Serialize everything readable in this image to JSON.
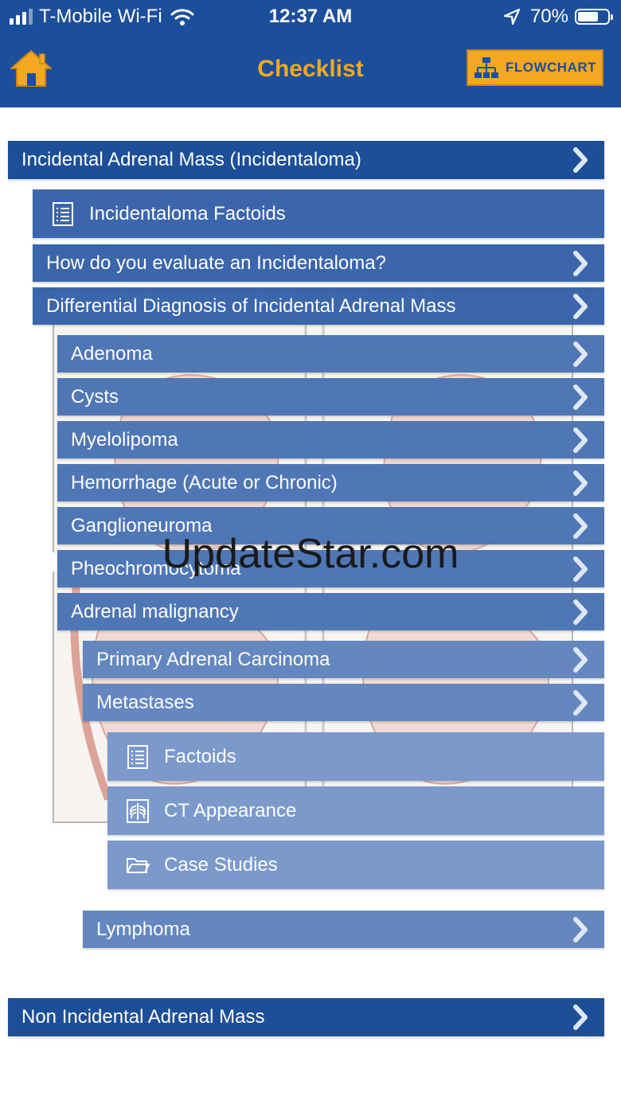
{
  "status_bar": {
    "carrier": "T-Mobile Wi-Fi",
    "time": "12:37 AM",
    "battery": "70%",
    "battery_level": 0.7
  },
  "nav": {
    "title": "Checklist",
    "flowchart_label": "FLOWCHART",
    "home_icon": "home-icon",
    "flowchart_icon": "flowchart-icon"
  },
  "colors": {
    "nav_bar": "#1b4f9b",
    "accent": "#f4a720",
    "level_0": "#1d4f98",
    "level_1": "#3b66ab",
    "level_2": "#4f77b5",
    "level_3": "#6487c0",
    "level_4": "#7b9acb"
  },
  "checklist": {
    "incidental": {
      "label": "Incidental Adrenal Mass (Incidentaloma)"
    },
    "factoids_top": {
      "label": "Incidentaloma Factoids",
      "icon": "list-icon"
    },
    "evaluate": {
      "label": "How do you evaluate an Incidentaloma?"
    },
    "differential": {
      "label": "Differential Diagnosis of Incidental Adrenal Mass"
    },
    "adenoma": {
      "label": "Adenoma"
    },
    "cysts": {
      "label": "Cysts"
    },
    "myelolipoma": {
      "label": "Myelolipoma"
    },
    "hemorrhage": {
      "label": "Hemorrhage (Acute or Chronic)"
    },
    "ganglioneuroma": {
      "label": "Ganglioneuroma"
    },
    "pheo": {
      "label": "Pheochromocytoma"
    },
    "malignancy": {
      "label": "Adrenal malignancy"
    },
    "primary": {
      "label": "Primary Adrenal Carcinoma"
    },
    "metastases": {
      "label": "Metastases"
    },
    "factoids": {
      "label": "Factoids",
      "icon": "list-icon"
    },
    "ct": {
      "label": "CT Appearance",
      "icon": "xray-icon"
    },
    "cases": {
      "label": "Case Studies",
      "icon": "folder-icon"
    },
    "lymphoma": {
      "label": "Lymphoma"
    },
    "non_incidental": {
      "label": "Non Incidental Adrenal Mass"
    }
  },
  "watermark": "UpdateStar.com"
}
